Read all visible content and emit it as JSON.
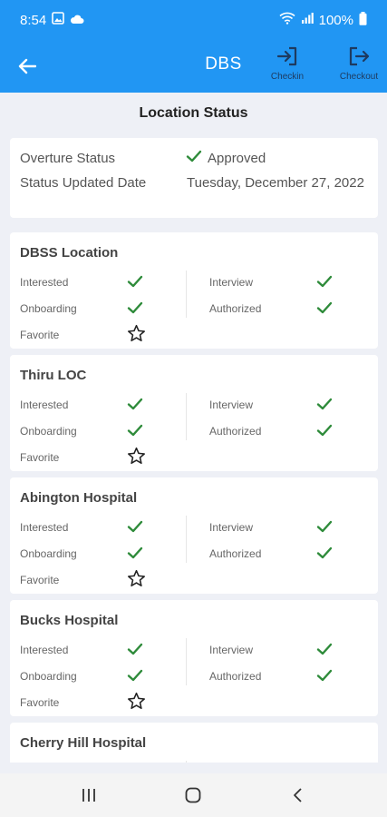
{
  "status_bar": {
    "time": "8:54",
    "battery": "100%"
  },
  "app_bar": {
    "title": "DBS",
    "checkin_label": "Checkin",
    "checkout_label": "Checkout"
  },
  "section_title": "Location Status",
  "overture": {
    "status_label": "Overture Status",
    "status_value": "Approved",
    "date_label": "Status Updated Date",
    "date_value": "Tuesday, December 27, 2022"
  },
  "labels": {
    "interested": "Interested",
    "interview": "Interview",
    "onboarding": "Onboarding",
    "authorized": "Authorized",
    "favorite": "Favorite"
  },
  "locations": [
    {
      "name": "DBSS Location",
      "interested": true,
      "interview": true,
      "onboarding": true,
      "authorized": true,
      "favorite": false
    },
    {
      "name": "Thiru LOC",
      "interested": true,
      "interview": true,
      "onboarding": true,
      "authorized": true,
      "favorite": false
    },
    {
      "name": "Abington Hospital",
      "interested": true,
      "interview": true,
      "onboarding": true,
      "authorized": true,
      "favorite": false
    },
    {
      "name": "Bucks Hospital",
      "interested": true,
      "interview": true,
      "onboarding": true,
      "authorized": true,
      "favorite": false
    },
    {
      "name": "Cherry Hill Hospital"
    }
  ],
  "colors": {
    "primary": "#2196f3",
    "check": "#2e8b3a",
    "background": "#eef0f6"
  }
}
